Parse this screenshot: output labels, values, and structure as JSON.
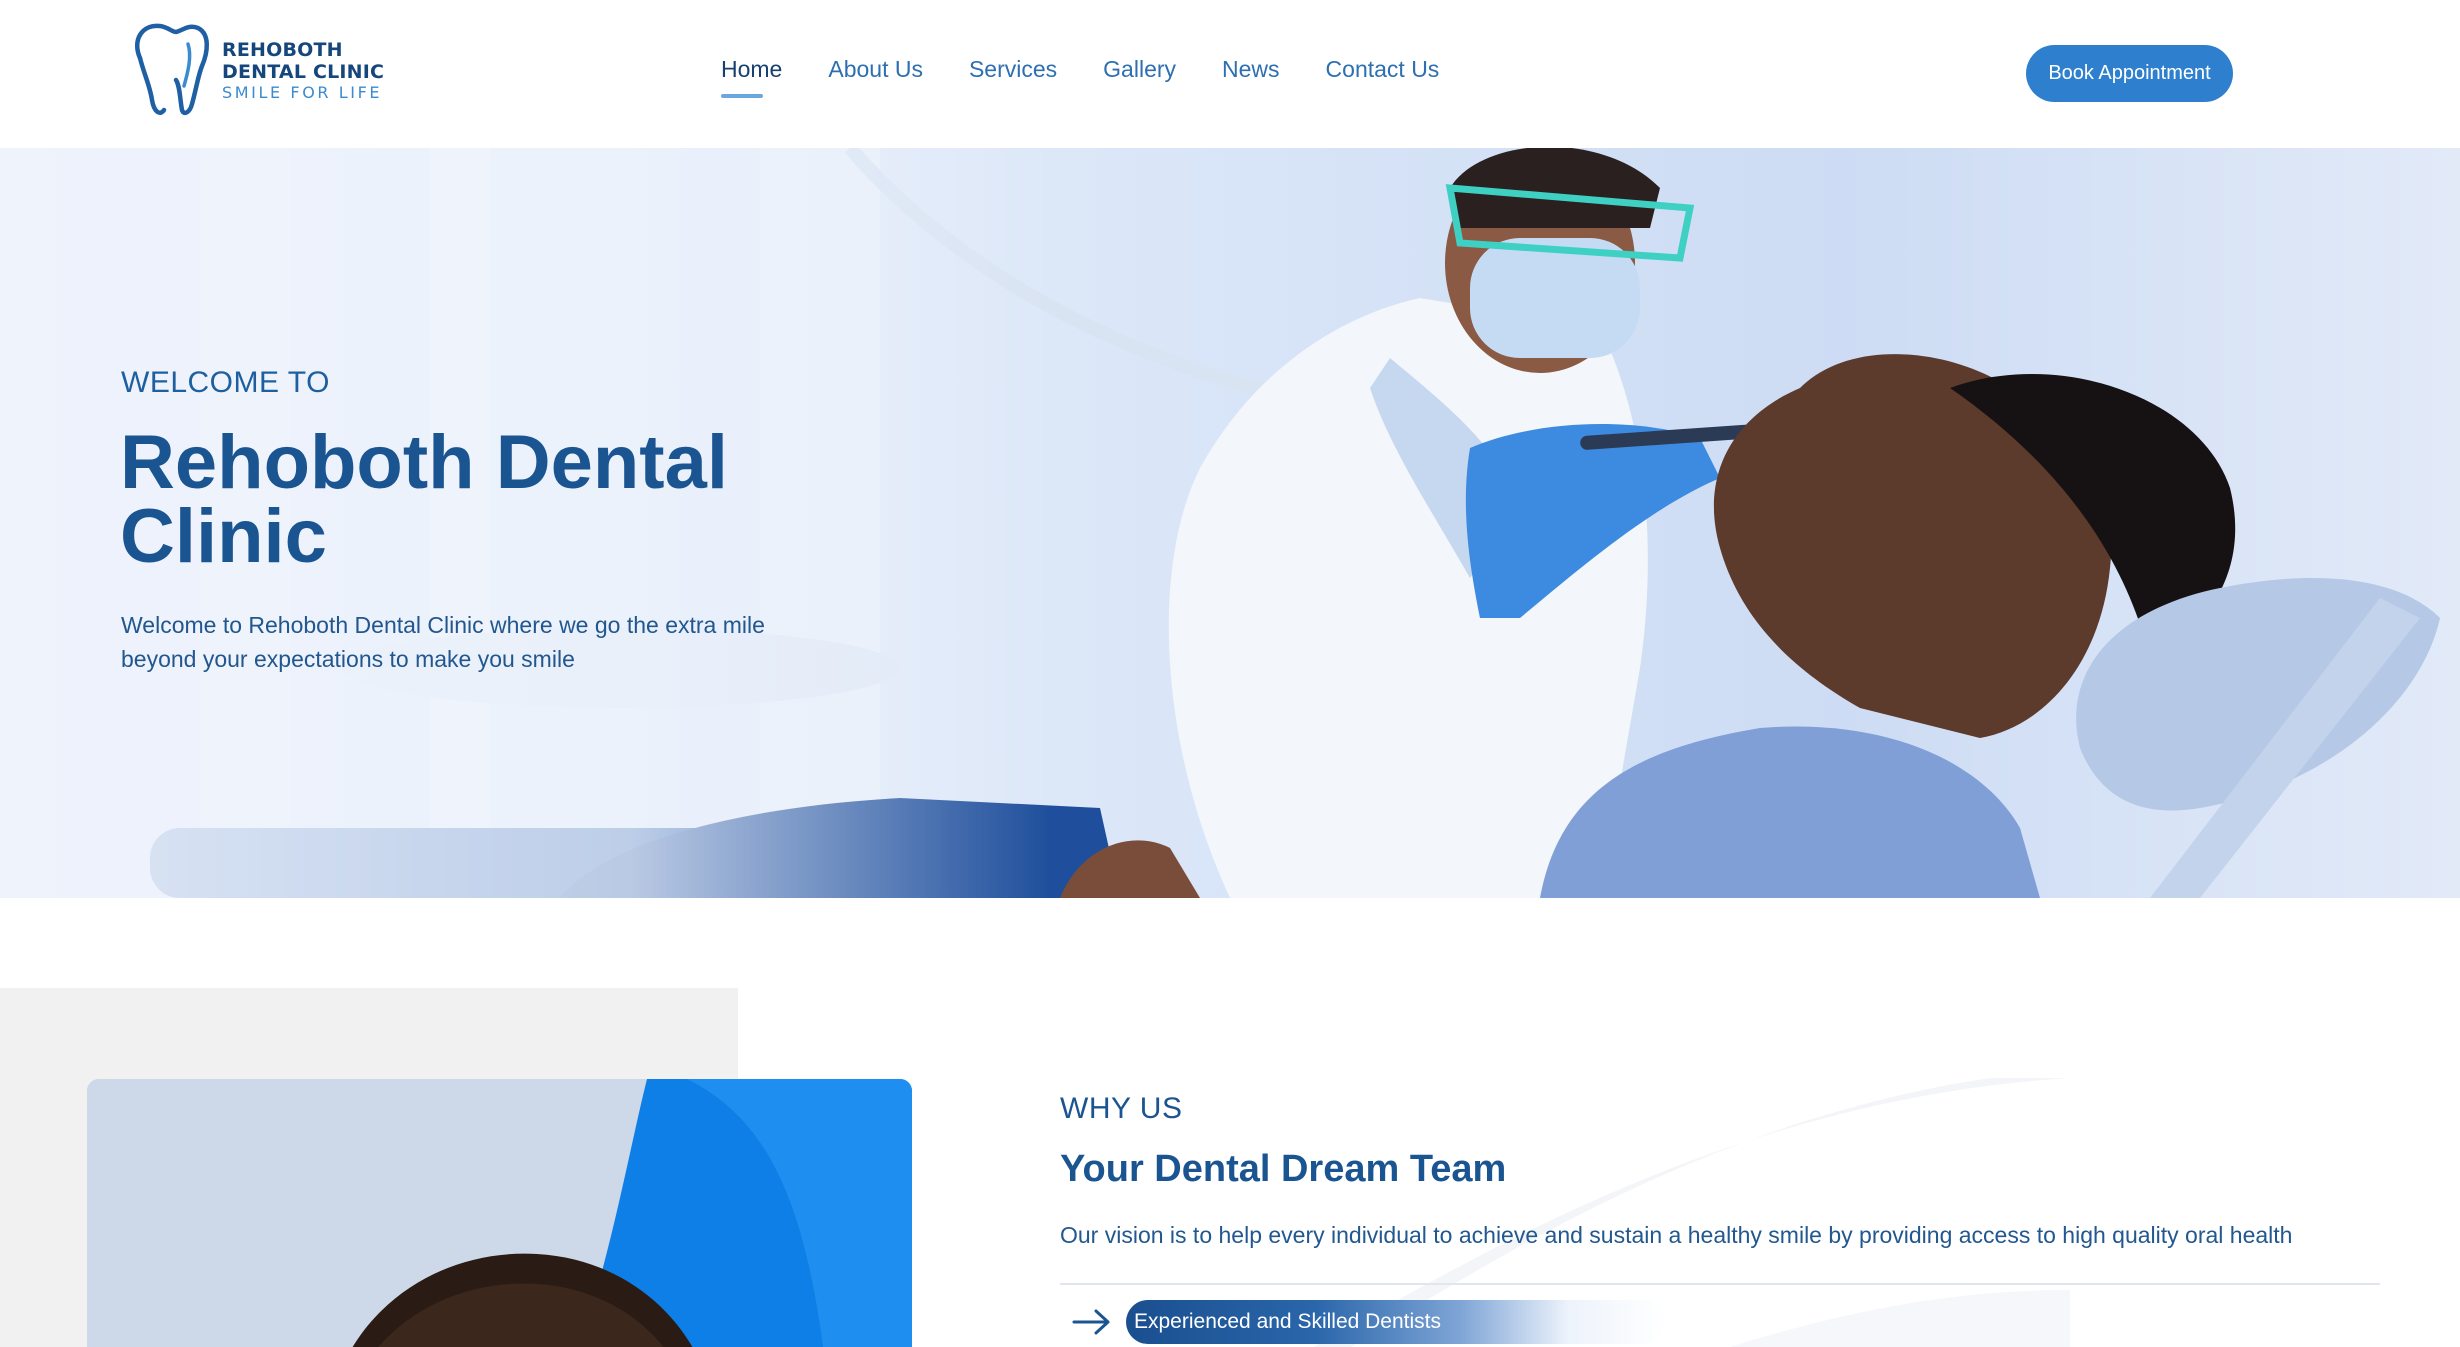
{
  "header": {
    "logo": {
      "name_line1": "REHOBOTH",
      "name_line2": "DENTAL CLINIC",
      "tagline": "SMILE FOR LIFE",
      "icon": "tooth-icon"
    },
    "nav": [
      {
        "label": "Home",
        "active": true
      },
      {
        "label": "About Us",
        "active": false
      },
      {
        "label": "Services",
        "active": false
      },
      {
        "label": "Gallery",
        "active": false
      },
      {
        "label": "News",
        "active": false
      },
      {
        "label": "Contact Us",
        "active": false
      }
    ],
    "cta_label": "Book Appointment"
  },
  "hero": {
    "eyebrow": "WELCOME TO",
    "title": "Rehoboth Dental Clinic",
    "description": "Welcome to Rehoboth Dental Clinic where we go the extra mile beyond your expectations to make you smile"
  },
  "why_us": {
    "eyebrow": "WHY US",
    "title": "Your Dental Dream Team",
    "description": "Our vision is to help every individual to achieve and sustain a healthy smile by providing access to high quality oral health",
    "features": [
      {
        "label": "Experienced and Skilled Dentists",
        "icon": "arrow-right-icon"
      }
    ]
  },
  "colors": {
    "brand_dark": "#1b5591",
    "brand_link": "#2d6fb0",
    "button_bg": "#2e80cf",
    "accent_underline": "#6aa7dc"
  }
}
